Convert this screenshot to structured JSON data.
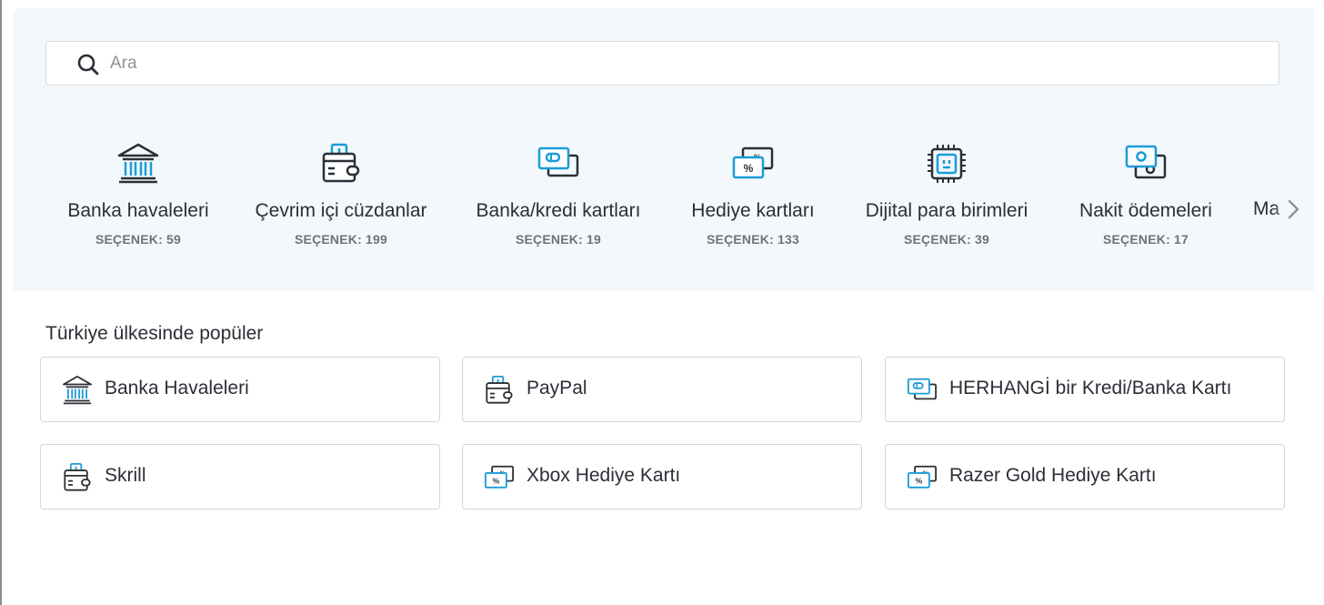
{
  "search": {
    "placeholder": "Ara",
    "value": ""
  },
  "categories": [
    {
      "label": "Banka havaleleri",
      "count": "SEÇENEK: 59",
      "icon": "bank-icon"
    },
    {
      "label": "Çevrim içi cüzdanlar",
      "count": "SEÇENEK: 199",
      "icon": "wallet-icon"
    },
    {
      "label": "Banka/kredi kartları",
      "count": "SEÇENEK: 19",
      "icon": "credit-card-icon"
    },
    {
      "label": "Hediye kartları",
      "count": "SEÇENEK: 133",
      "icon": "gift-card-icon"
    },
    {
      "label": "Dijital para birimleri",
      "count": "SEÇENEK: 39",
      "icon": "crypto-chip-icon"
    },
    {
      "label": "Nakit ödemeleri",
      "count": "SEÇENEK: 17",
      "icon": "cash-icon"
    },
    {
      "label": "Ma",
      "icon": ""
    }
  ],
  "popular": {
    "title": "Türkiye ülkesinde popüler",
    "items": [
      {
        "label": "Banka Havaleleri",
        "icon": "bank-icon"
      },
      {
        "label": "PayPal",
        "icon": "wallet-icon"
      },
      {
        "label": "HERHANGİ bir Kredi/Banka Kartı",
        "icon": "credit-card-icon"
      },
      {
        "label": "Skrill",
        "icon": "wallet-icon"
      },
      {
        "label": "Xbox Hediye Kartı",
        "icon": "gift-card-icon"
      },
      {
        "label": "Razer Gold Hediye Kartı",
        "icon": "gift-card-icon"
      }
    ]
  },
  "colors": {
    "accent": "#1a9cd8",
    "dark": "#2b2f36",
    "panel_bg": "#f3f8fc"
  }
}
